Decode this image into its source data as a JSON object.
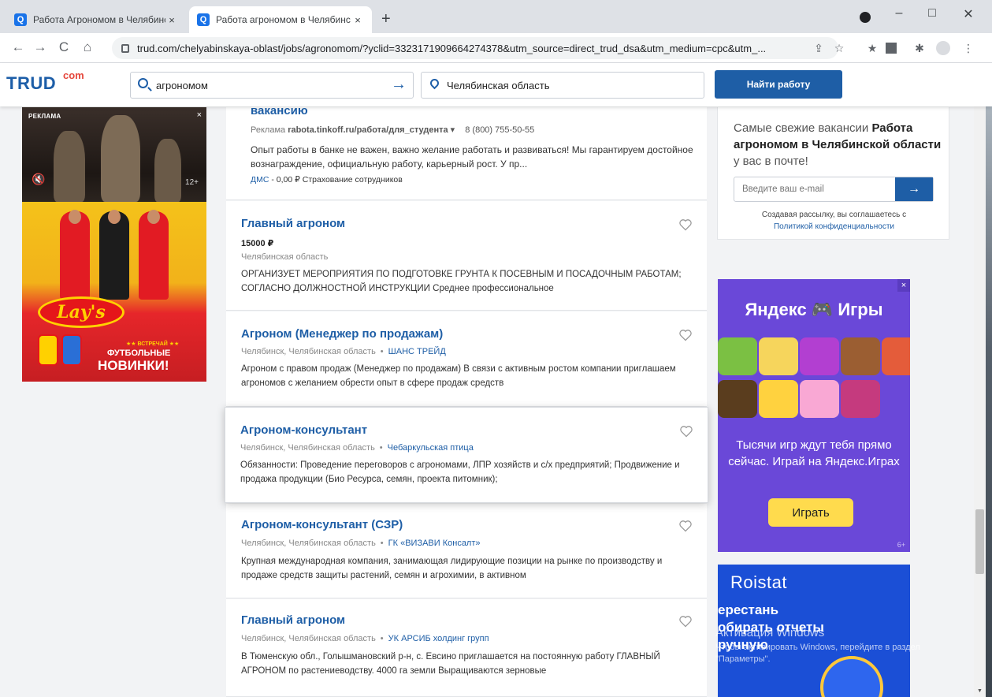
{
  "browser": {
    "tabs": [
      {
        "title": "Работа Агрономом в Челябинс",
        "active": false
      },
      {
        "title": "Работа агрономом в Челябинс",
        "active": true
      }
    ],
    "url": "trud.com/chelyabinskaya-oblast/jobs/agronomom/?yclid=3323171909664274378&utm_source=direct_trud_dsa&utm_medium=cpc&utm_...",
    "favicon_letter": "Q",
    "new_tab": "+",
    "close_glyph": "×",
    "win": {
      "minimize": "–",
      "maximize": "□",
      "close": "✕"
    },
    "nav": {
      "back": "←",
      "forward": "→",
      "reload": "C",
      "home": "⌂"
    },
    "ext_icons": {
      "share": "⇪",
      "star": "☆",
      "star2": "★",
      "puzzle": "✱",
      "menu": "⋮"
    }
  },
  "header": {
    "logo": "TRUD",
    "logo_suffix": "com",
    "search_value": "агрономом",
    "search_arrow": "→",
    "region_value": "Челябинская область",
    "find_button": "Найти работу"
  },
  "left_ad": {
    "label": "РЕКЛАМА",
    "close": "×",
    "mute": "🔇",
    "age": "12+",
    "logo": "Lay's",
    "small": "★★ ВСТРЕЧАЙ ★★",
    "line1": "ФУТБОЛЬНЫЕ",
    "line2": "НОВИНКИ!"
  },
  "ad_card": {
    "title": "вакансию",
    "meta_prefix": "Реклама",
    "meta_domain": "rabota.tinkoff.ru/работа/для_студента ▾",
    "phone": "8 (800) 755-50-55",
    "desc": "Опыт работы в банке не важен, важно желание работать и развиваться! Мы гарантируем достойное вознаграждение, официальную работу, карьерный рост. У пр...",
    "link1": "ДМС",
    "sep": " - ",
    "link2_text": "0,00 ₽ Страхование сотрудников"
  },
  "jobs": [
    {
      "title": "Главный агроном",
      "salary": "15000 ₽",
      "location": "Челябинская область",
      "company": "",
      "desc": "ОРГАНИЗУЕТ МЕРОПРИЯТИЯ ПО ПОДГОТОВКЕ ГРУНТА К ПОСЕВНЫМ И ПОСАДОЧНЫМ РАБОТАМ; СОГЛАСНО ДОЛЖНОСТНОЙ ИНСТРУКЦИИ Среднее профессиональное"
    },
    {
      "title": "Агроном (Менеджер по продажам)",
      "salary": "",
      "location": "Челябинск, Челябинская область",
      "company": "ШАНС ТРЕЙД",
      "desc": "Агроном с правом продаж (Менеджер по продажам) В связи с активным ростом компании приглашаем агрономов с желанием обрести опыт в сфере продаж средств"
    },
    {
      "title": "Агроном-консультант",
      "salary": "",
      "location": "Челябинск, Челябинская область",
      "company": "Чебаркульская птица",
      "desc": "Обязанности: Проведение переговоров с агрономами, ЛПР хозяйств и с/х предприятий; Продвижение и продажа продукции (Био Ресурса, семян, проекта питомник);"
    },
    {
      "title": "Агроном-консультант (СЗР)",
      "salary": "",
      "location": "Челябинск, Челябинская область",
      "company": "ГК «ВИЗАВИ Консалт»",
      "desc": "Крупная международная компания, занимающая лидирующие позиции на рынке по производству и продаже средств защиты растений, семян и агрохимии, в активном"
    },
    {
      "title": "Главный агроном",
      "salary": "",
      "location": "Челябинск, Челябинская область",
      "company": "УК АРСИБ холдинг групп",
      "desc": "В Тюменскую обл., Голышмановский р-н, с. Евсино приглашается на постоянную работу ГЛАВНЫЙ АГРОНОМ по растениеводству. 4000 га земли Выращиваются зерновые"
    }
  ],
  "separator": "•",
  "subscribe": {
    "text_prefix": "Самые свежие вакансии ",
    "text_bold": "Работа агрономом в Челябинской области",
    "text_suffix": " у вас в почте!",
    "email_placeholder": "Введите ваш e-mail",
    "button": "→",
    "agree": "Создавая рассылку, вы соглашаетесь с",
    "policy": "Политикой конфиденциальности"
  },
  "yandex_ad": {
    "title": "Яндекс 🎮 Игры",
    "close": "×",
    "sub": "Тысячи игр ждут тебя прямо сейчас. Играй на Яндекс.Играх",
    "button": "Играть",
    "age": "6+"
  },
  "roistat_ad": {
    "logo": "Roistat",
    "l1": "ерестань",
    "l2": "обирать отчеты",
    "l3": "ручную"
  },
  "watermark": {
    "line1": "Активация Windows",
    "line2": "Чтобы активировать Windows, перейдите в раздел \"Параметры\"."
  },
  "colors": {
    "brand": "#1e5ea6",
    "accent_red": "#e5473c",
    "ya_purple": "#6a48d8",
    "roistat_blue": "#1b4fd6"
  }
}
